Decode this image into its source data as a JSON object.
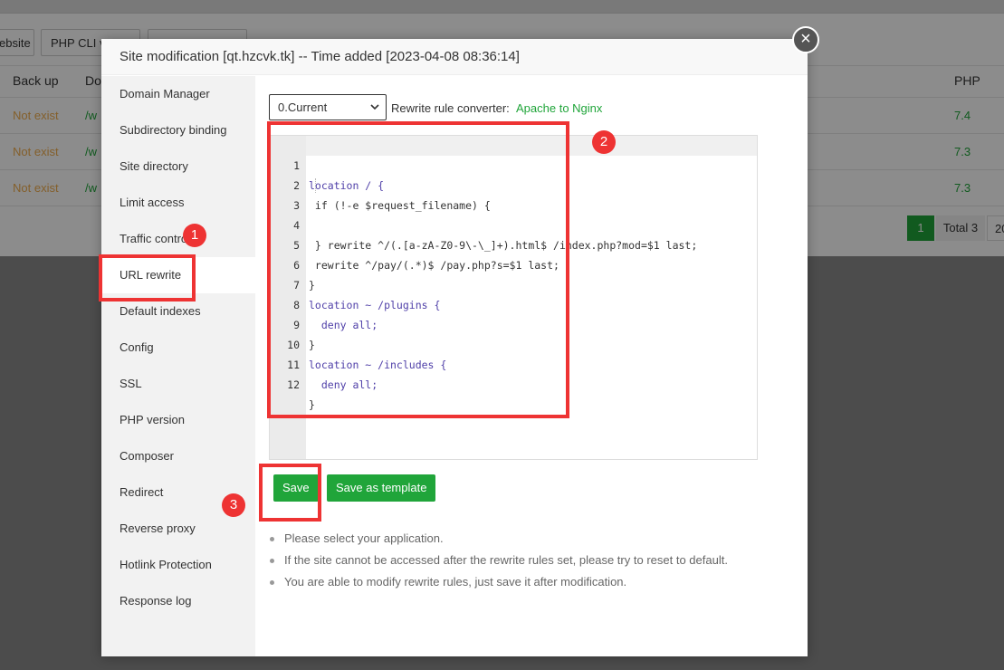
{
  "background": {
    "toolbar": [
      "ebsite",
      "PHP CLI v"
    ],
    "table": {
      "headers": [
        "Back up",
        "Do",
        "PHP"
      ],
      "rows": [
        {
          "backup": "Not exist",
          "path": "/w",
          "php": "7.4"
        },
        {
          "backup": "Not exist",
          "path": "/w",
          "php": "7.3"
        },
        {
          "backup": "Not exist",
          "path": "/w",
          "php": "7.3"
        }
      ]
    },
    "pager": {
      "current": "1",
      "total": "Total 3",
      "size": "20"
    }
  },
  "modal": {
    "title": "Site modification [qt.hzcvk.tk] -- Time added [2023-04-08 08:36:14]",
    "close_icon": "×",
    "sidebar": [
      {
        "label": "Domain Manager"
      },
      {
        "label": "Subdirectory binding"
      },
      {
        "label": "Site directory"
      },
      {
        "label": "Limit access"
      },
      {
        "label": "Traffic control"
      },
      {
        "label": "URL rewrite",
        "active": true
      },
      {
        "label": "Default indexes"
      },
      {
        "label": "Config"
      },
      {
        "label": "SSL"
      },
      {
        "label": "PHP version"
      },
      {
        "label": "Composer"
      },
      {
        "label": "Redirect"
      },
      {
        "label": "Reverse proxy"
      },
      {
        "label": "Hotlink Protection"
      },
      {
        "label": "Response log"
      }
    ],
    "rewrite": {
      "select_value": "0.Current",
      "converter_label": "Rewrite rule converter:",
      "converter_link": "Apache to Nginx",
      "code_lines": [
        "location / {",
        " if (!-e $request_filename) {",
        "   rewrite ^/(.[a-zA-Z0-9\\-\\_]+).html$ /index.php?mod=$1 last;",
        " }",
        " rewrite ^/pay/(.*)$ /pay.php?s=$1 last;",
        "}",
        "location ~ /plugins {",
        "  deny all;",
        "}",
        "location ~ /includes {",
        "  deny all;",
        "}"
      ],
      "save_label": "Save",
      "save_template_label": "Save as template",
      "tips": [
        "Please select your application.",
        "If the site cannot be accessed after the rewrite rules set, please try to reset to default.",
        "You are able to modify rewrite rules, just save it after modification."
      ]
    }
  },
  "annotations": {
    "badge1": "1",
    "badge2": "2",
    "badge3": "3"
  },
  "colors": {
    "accent_green": "#20a53a",
    "annotation_red": "#ee3333",
    "warning_orange": "#f0ad4e"
  }
}
